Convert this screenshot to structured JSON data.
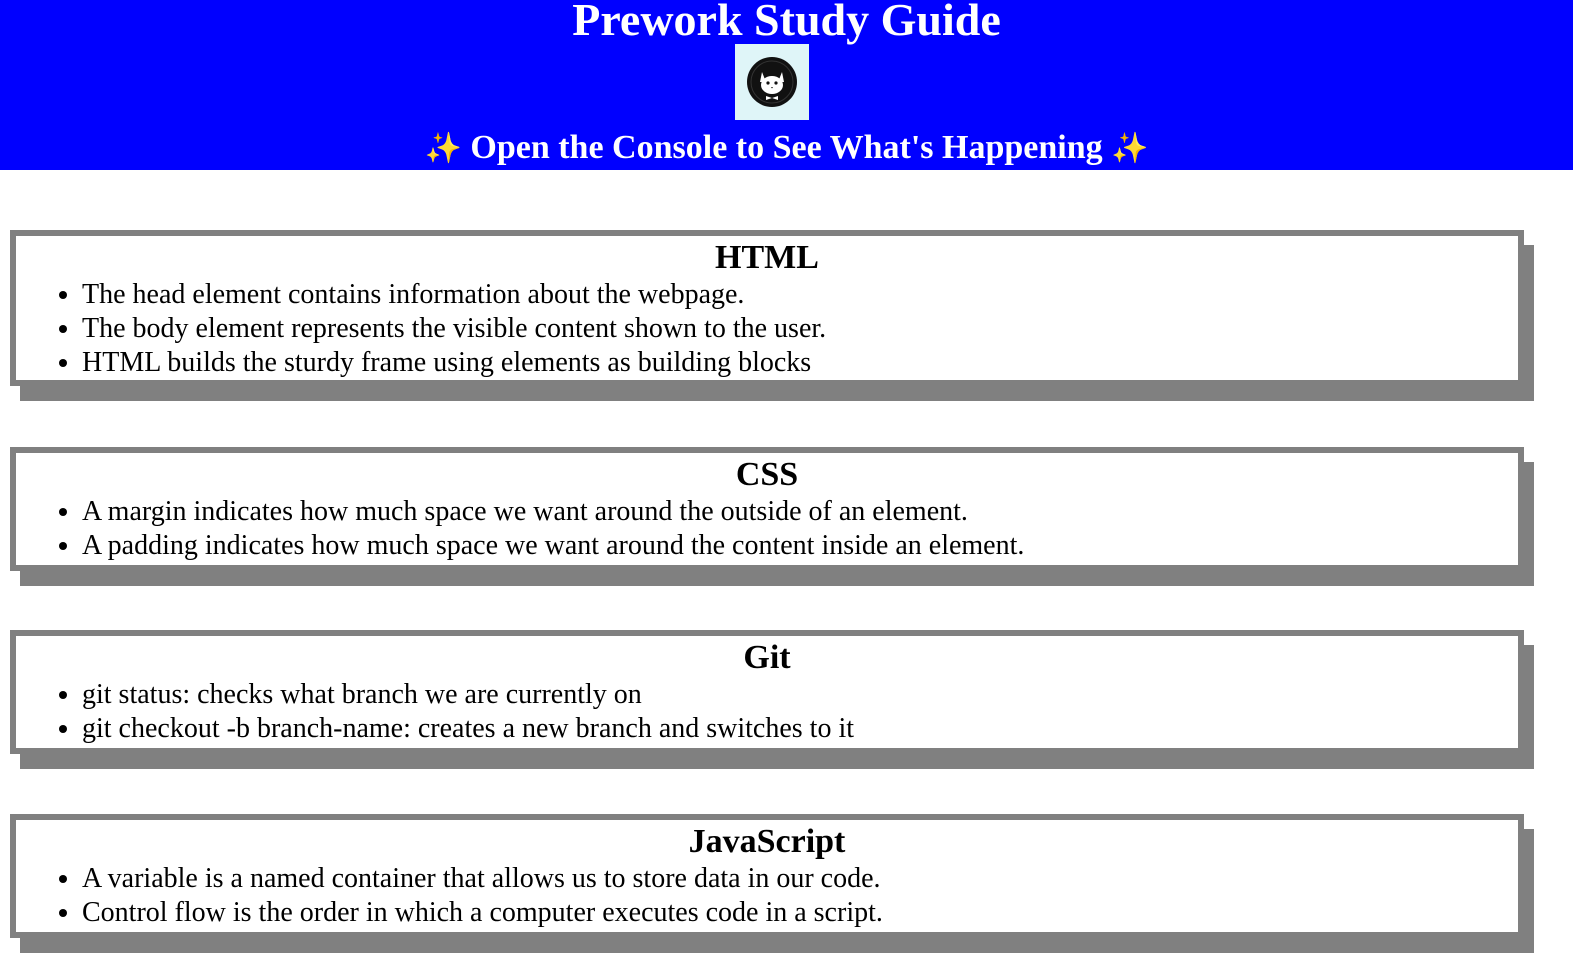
{
  "header": {
    "title": "Prework Study Guide",
    "subtitle": "Open the Console to See What's Happening",
    "sparkle": "✨",
    "background_color": "#0000ff",
    "avatar_icon": "cat-avatar-icon"
  },
  "sections": [
    {
      "heading": "HTML",
      "items": [
        "The head element contains information about the webpage.",
        "The body element represents the visible content shown to the user.",
        "HTML builds the sturdy frame using elements as building blocks"
      ]
    },
    {
      "heading": "CSS",
      "items": [
        "A margin indicates how much space we want around the outside of an element.",
        "A padding indicates how much space we want around the content inside an element."
      ]
    },
    {
      "heading": "Git",
      "items": [
        "git status: checks what branch we are currently on",
        "git checkout -b branch-name: creates a new branch and switches to it"
      ]
    },
    {
      "heading": "JavaScript",
      "items": [
        "A variable is a named container that allows us to store data in our code.",
        "Control flow is the order in which a computer executes code in a script."
      ]
    }
  ]
}
